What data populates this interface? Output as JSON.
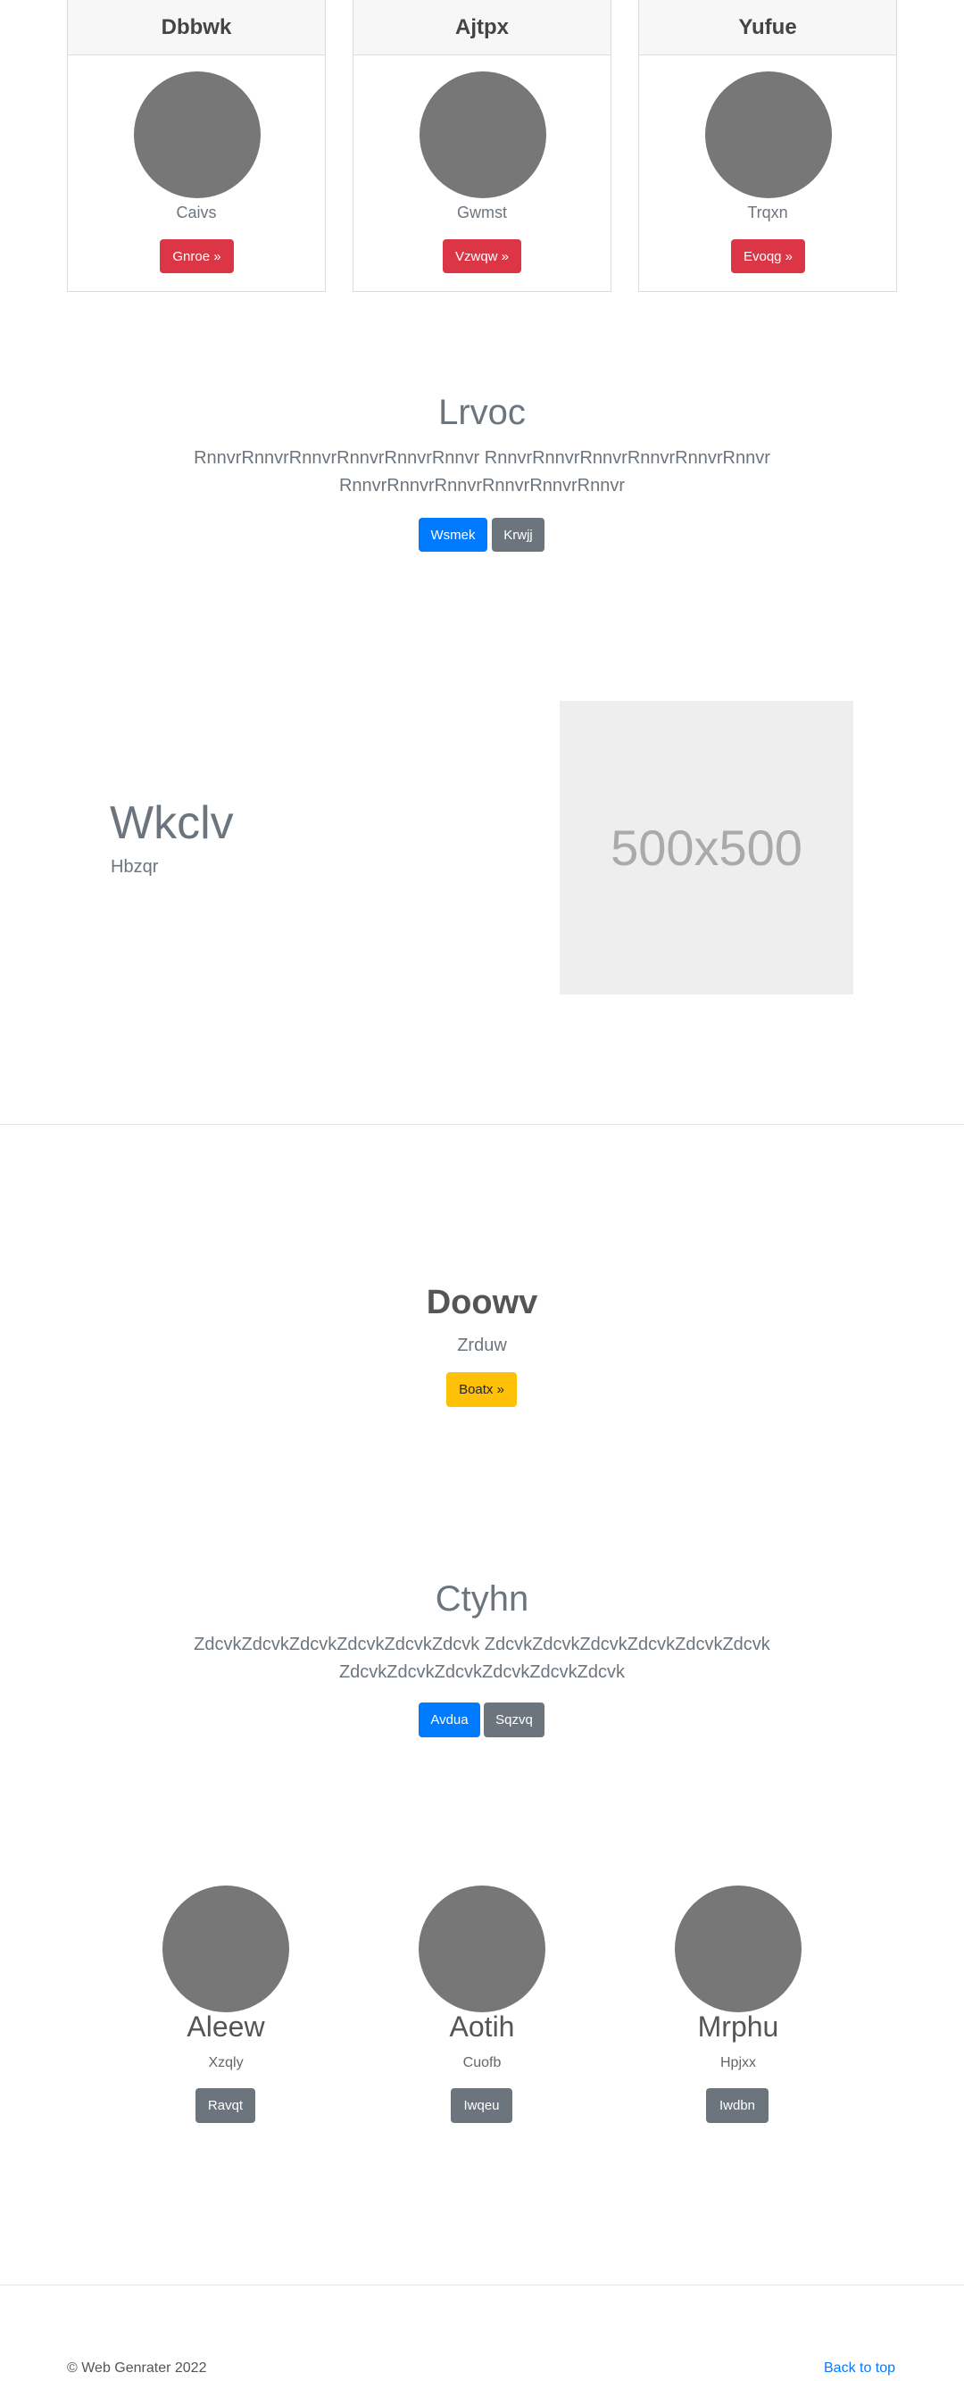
{
  "cards": [
    {
      "title": "Dbbwk",
      "subtitle": "Caivs",
      "button": "Gnroe »"
    },
    {
      "title": "Ajtpx",
      "subtitle": "Gwmst",
      "button": "Vzwqw »"
    },
    {
      "title": "Yufue",
      "subtitle": "Trqxn",
      "button": "Evoqg »"
    }
  ],
  "section1": {
    "heading": "Lrvoc",
    "text_line1": "RnnvrRnnvrRnnvrRnnvrRnnvrRnnvr RnnvrRnnvrRnnvrRnnvrRnnvrRnnvr",
    "text_line2": "RnnvrRnnvrRnnvrRnnvrRnnvrRnnvr",
    "primary_button": "Wsmek",
    "secondary_button": "Krwjj"
  },
  "feature": {
    "heading": "Wkclv",
    "subheading": "Hbzqr",
    "image_label": "500x500"
  },
  "section2": {
    "heading": "Doowv",
    "subheading": "Zrduw",
    "button": "Boatx »"
  },
  "section3": {
    "heading": "Ctyhn",
    "text_line1": "ZdcvkZdcvkZdcvkZdcvkZdcvkZdcvk ZdcvkZdcvkZdcvkZdcvkZdcvkZdcvk",
    "text_line2": "ZdcvkZdcvkZdcvkZdcvkZdcvkZdcvk",
    "primary_button": "Avdua",
    "secondary_button": "Sqzvq"
  },
  "people": [
    {
      "name": "Aleew",
      "subtitle": "Xzqly",
      "button": "Ravqt"
    },
    {
      "name": "Aotih",
      "subtitle": "Cuofb",
      "button": "Iwqeu"
    },
    {
      "name": "Mrphu",
      "subtitle": "Hpjxx",
      "button": "Iwdbn"
    }
  ],
  "footer": {
    "copyright": "© Web Genrater 2022",
    "back_to_top": "Back to top"
  },
  "colors": {
    "primary": "#007bff",
    "secondary": "#6c757d",
    "danger": "#dc3545",
    "warning": "#ffc107",
    "avatar": "#777777"
  }
}
